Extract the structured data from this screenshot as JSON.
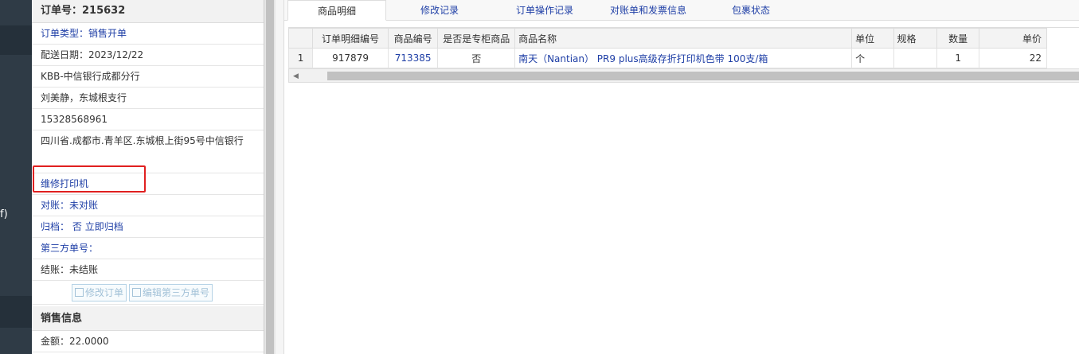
{
  "nav": {
    "fragment": "f)"
  },
  "order": {
    "header": "订单号：215632",
    "order_type": "订单类型：销售开单",
    "delivery_date": "配送日期：2023/12/22",
    "customer": "KBB-中信银行成都分行",
    "contact": "刘美静，东城根支行",
    "phone": "15328568961",
    "address": "四川省.成都市.青羊区.东城根上街95号中信银行",
    "remark": "维修打印机",
    "reconcile": "对账：未对账",
    "archive_label": "归档：",
    "archive_value": "否",
    "archive_link": "立即归档",
    "third_party": "第三方单号：",
    "settle": "结账：未结账",
    "btn_edit_order": "修改订单",
    "btn_edit_third": "编辑第三方单号",
    "sales_header": "销售信息",
    "amount": "金额：22.0000"
  },
  "tabs": [
    "商品明细",
    "修改记录",
    "订单操作记录",
    "对账单和发票信息",
    "包裹状态"
  ],
  "grid": {
    "columns": [
      "",
      "订单明细编号",
      "商品编号",
      "是否是专柜商品",
      "商品名称",
      "单位",
      "规格",
      "数量",
      "单价"
    ],
    "rows": [
      [
        "1",
        "917879",
        "713385",
        "否",
        "南天（Nantian） PR9 plus高级存折打印机色带 100支/箱",
        "个",
        "",
        "1",
        "22"
      ]
    ]
  },
  "colors": {
    "link": "#1f3fa6",
    "highlight": "#e02020",
    "nav": "#2f3b46"
  }
}
